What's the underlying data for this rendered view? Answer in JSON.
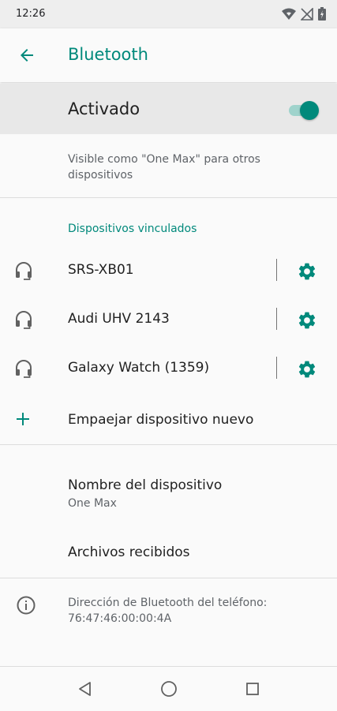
{
  "status_bar": {
    "time": "12:26",
    "icons": [
      "wifi-icon",
      "no-signal-icon",
      "battery-charging-icon"
    ]
  },
  "app_bar": {
    "title": "Bluetooth",
    "back_icon": "arrow-back-icon"
  },
  "master_switch": {
    "label": "Activado",
    "state": "on"
  },
  "visibility": {
    "text": "Visible como \"One Max\" para otros dispositivos"
  },
  "paired_section": {
    "header": "Dispositivos vinculados",
    "devices": [
      {
        "name": "SRS-XB01",
        "icon": "headset-icon",
        "settings_icon": "gear-icon"
      },
      {
        "name": "Audi UHV 2143",
        "icon": "headset-icon",
        "settings_icon": "gear-icon"
      },
      {
        "name": "Galaxy Watch (1359)",
        "icon": "headset-icon",
        "settings_icon": "gear-icon"
      }
    ],
    "pair_new": {
      "label": "Empaejar dispositivo nuevo",
      "icon": "plus-icon"
    }
  },
  "device_name": {
    "title": "Nombre del dispositivo",
    "value": "One Max"
  },
  "received_files": {
    "label": "Archivos recibidos"
  },
  "bt_address": {
    "label": "Dirección de Bluetooth del teléfono:",
    "value": "76:47:46:00:00:4A",
    "icon": "info-icon"
  },
  "nav_bar": {
    "buttons": [
      "back-triangle-icon",
      "home-circle-icon",
      "recents-square-icon"
    ]
  },
  "colors": {
    "accent": "#00897b",
    "background": "#fafafa",
    "switch_bar": "#e8e8e8",
    "secondary_text": "#5f6368"
  }
}
